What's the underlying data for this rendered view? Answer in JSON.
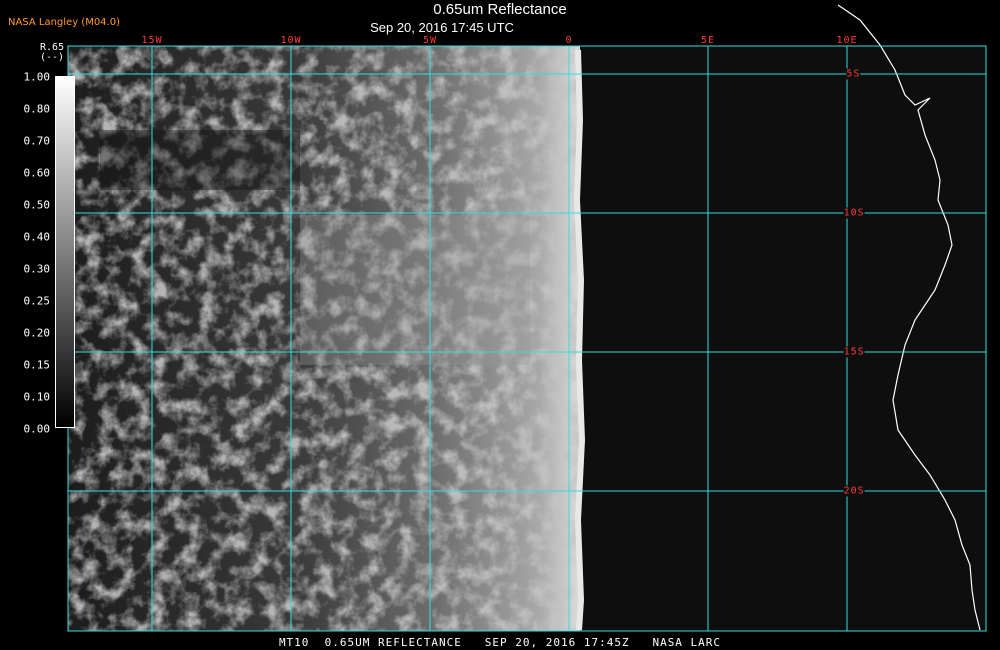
{
  "header": {
    "credit": "NASA Langley (M04.0)",
    "title": "0.65um Reflectance",
    "datetime": "Sep 20, 2016 17:45 UTC"
  },
  "legend": {
    "name": "R.65",
    "unit": "(--)",
    "ticks": [
      "1.00",
      "0.80",
      "0.70",
      "0.60",
      "0.50",
      "0.40",
      "0.30",
      "0.25",
      "0.20",
      "0.15",
      "0.10",
      "0.00"
    ]
  },
  "grid": {
    "longitudes": [
      "15W",
      "10W",
      "5W",
      "0",
      "5E",
      "10E"
    ],
    "latitudes": [
      "5S",
      "10S",
      "15S",
      "20S"
    ]
  },
  "footer": {
    "text": "MT10  0.65UM REFLECTANCE   SEP 20, 2016 17:45Z   NASA LARC"
  },
  "colors": {
    "grid": "#33dddd",
    "labels": "#ff3b3b",
    "credit": "#ff9933",
    "coast": "#ffffff"
  }
}
